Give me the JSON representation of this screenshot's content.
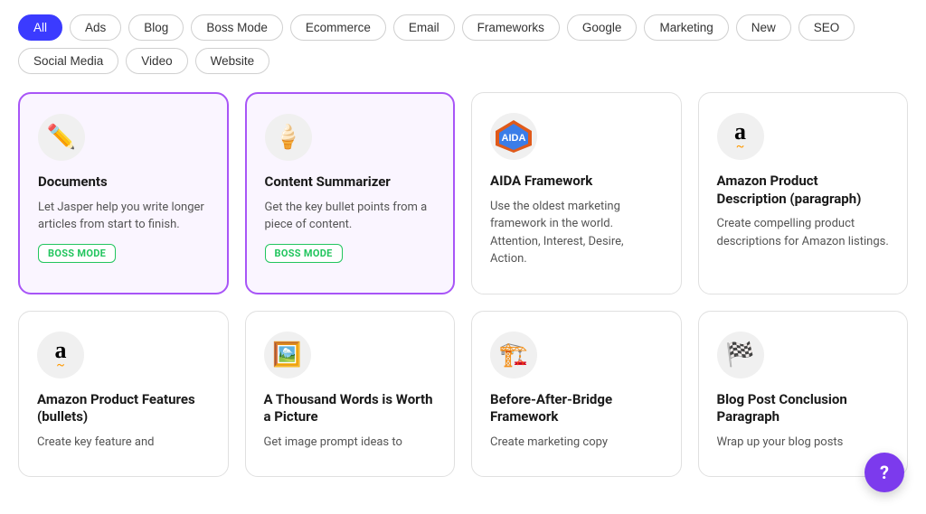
{
  "filters": {
    "tags": [
      {
        "label": "All",
        "active": true
      },
      {
        "label": "Ads",
        "active": false
      },
      {
        "label": "Blog",
        "active": false
      },
      {
        "label": "Boss Mode",
        "active": false
      },
      {
        "label": "Ecommerce",
        "active": false
      },
      {
        "label": "Email",
        "active": false
      },
      {
        "label": "Frameworks",
        "active": false
      },
      {
        "label": "Google",
        "active": false
      },
      {
        "label": "Marketing",
        "active": false
      },
      {
        "label": "New",
        "active": false
      },
      {
        "label": "SEO",
        "active": false
      },
      {
        "label": "Social Media",
        "active": false
      },
      {
        "label": "Video",
        "active": false
      },
      {
        "label": "Website",
        "active": false
      }
    ]
  },
  "cards": [
    {
      "id": "documents",
      "title": "Documents",
      "desc": "Let Jasper help you write longer articles from start to finish.",
      "badge": "BOSS MODE",
      "badge_type": "boss",
      "highlighted": true,
      "icon_type": "pencil"
    },
    {
      "id": "content-summarizer",
      "title": "Content Summarizer",
      "desc": "Get the key bullet points from a piece of content.",
      "badge": "BOSS MODE",
      "badge_type": "boss",
      "highlighted": true,
      "icon_type": "ice-cream"
    },
    {
      "id": "aida-framework",
      "title": "AIDA Framework",
      "desc": "Use the oldest marketing framework in the world. Attention, Interest, Desire, Action.",
      "badge": "",
      "badge_type": "",
      "highlighted": false,
      "icon_type": "aida"
    },
    {
      "id": "amazon-product-desc",
      "title": "Amazon Product Description (paragraph)",
      "desc": "Create compelling product descriptions for Amazon listings.",
      "badge": "",
      "badge_type": "",
      "highlighted": false,
      "icon_type": "amazon"
    },
    {
      "id": "amazon-product-features",
      "title": "Amazon Product Features (bullets)",
      "desc": "Create key feature and",
      "badge": "",
      "badge_type": "",
      "highlighted": false,
      "icon_type": "amazon-bullets"
    },
    {
      "id": "thousand-words",
      "title": "A Thousand Words is Worth a Picture",
      "desc": "Get image prompt ideas to",
      "badge": "",
      "badge_type": "",
      "highlighted": false,
      "icon_type": "picture"
    },
    {
      "id": "before-after-bridge",
      "title": "Before-After-Bridge Framework",
      "desc": "Create marketing copy",
      "badge": "",
      "badge_type": "",
      "highlighted": false,
      "icon_type": "bridge"
    },
    {
      "id": "blog-post-conclusion",
      "title": "Blog Post Conclusion Paragraph",
      "desc": "Wrap up your blog posts",
      "badge": "",
      "badge_type": "",
      "highlighted": false,
      "icon_type": "flag"
    }
  ],
  "help_button_label": "?"
}
